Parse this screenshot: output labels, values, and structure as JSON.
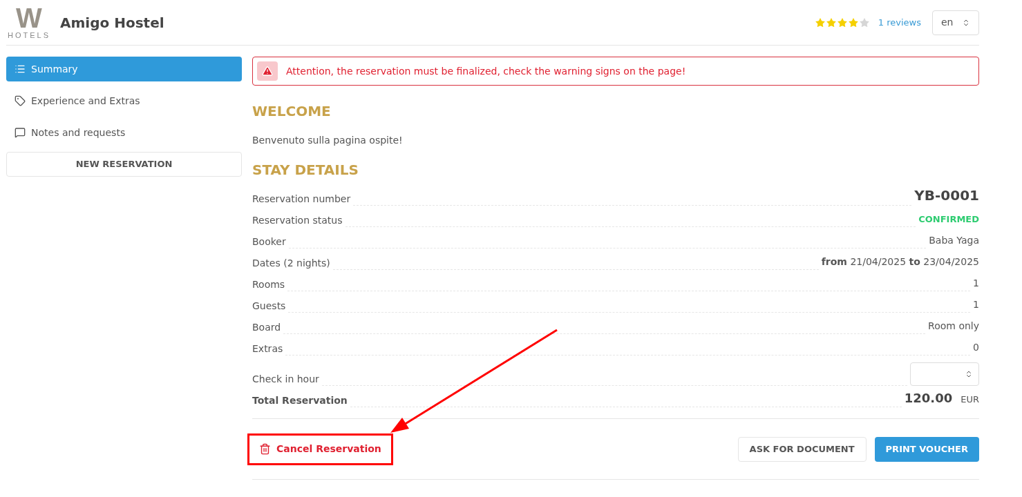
{
  "header": {
    "logo": {
      "mark": "W",
      "word": "HOTELS"
    },
    "title": "Amigo Hostel",
    "stars": 4,
    "reviews_link": "1 reviews",
    "language": "en"
  },
  "sidebar": {
    "items": [
      {
        "label": "Summary",
        "selected": true
      },
      {
        "label": "Experience and Extras",
        "selected": false
      },
      {
        "label": "Notes and requests",
        "selected": false
      }
    ],
    "new_button": "NEW RESERVATION"
  },
  "alert": "Attention, the reservation must be finalized, check the warning signs on the page!",
  "welcome": {
    "heading": "WELCOME",
    "text": "Benvenuto sulla pagina ospite!"
  },
  "stay": {
    "heading": "STAY DETAILS",
    "rows": [
      {
        "kind": "big",
        "label": "Reservation number",
        "value": "YB-0001"
      },
      {
        "kind": "status",
        "label": "Reservation status",
        "value": "CONFIRMED",
        "color": "#2ecc71"
      },
      {
        "kind": "text",
        "label": "Booker",
        "value": "Baba Yaga"
      },
      {
        "kind": "text",
        "label": "Dates (2 nights)",
        "value": "**from** 21/04/2025 **to** 23/04/2025"
      },
      {
        "kind": "text",
        "label": "Rooms",
        "value": "1"
      },
      {
        "kind": "text",
        "label": "Guests",
        "value": "1"
      },
      {
        "kind": "text",
        "label": "Board",
        "value": "Room only"
      },
      {
        "kind": "text",
        "label": "Extras",
        "value": "0"
      },
      {
        "kind": "select",
        "label": "Check in hour"
      },
      {
        "kind": "total",
        "label": "Total Reservation",
        "value": "120.00",
        "currency": "EUR"
      }
    ]
  },
  "actions": {
    "cancel": {
      "label": "Cancel Reservation",
      "highlighted": true
    },
    "ask": "ASK FOR DOCUMENT",
    "print": "PRINT VOUCHER"
  }
}
